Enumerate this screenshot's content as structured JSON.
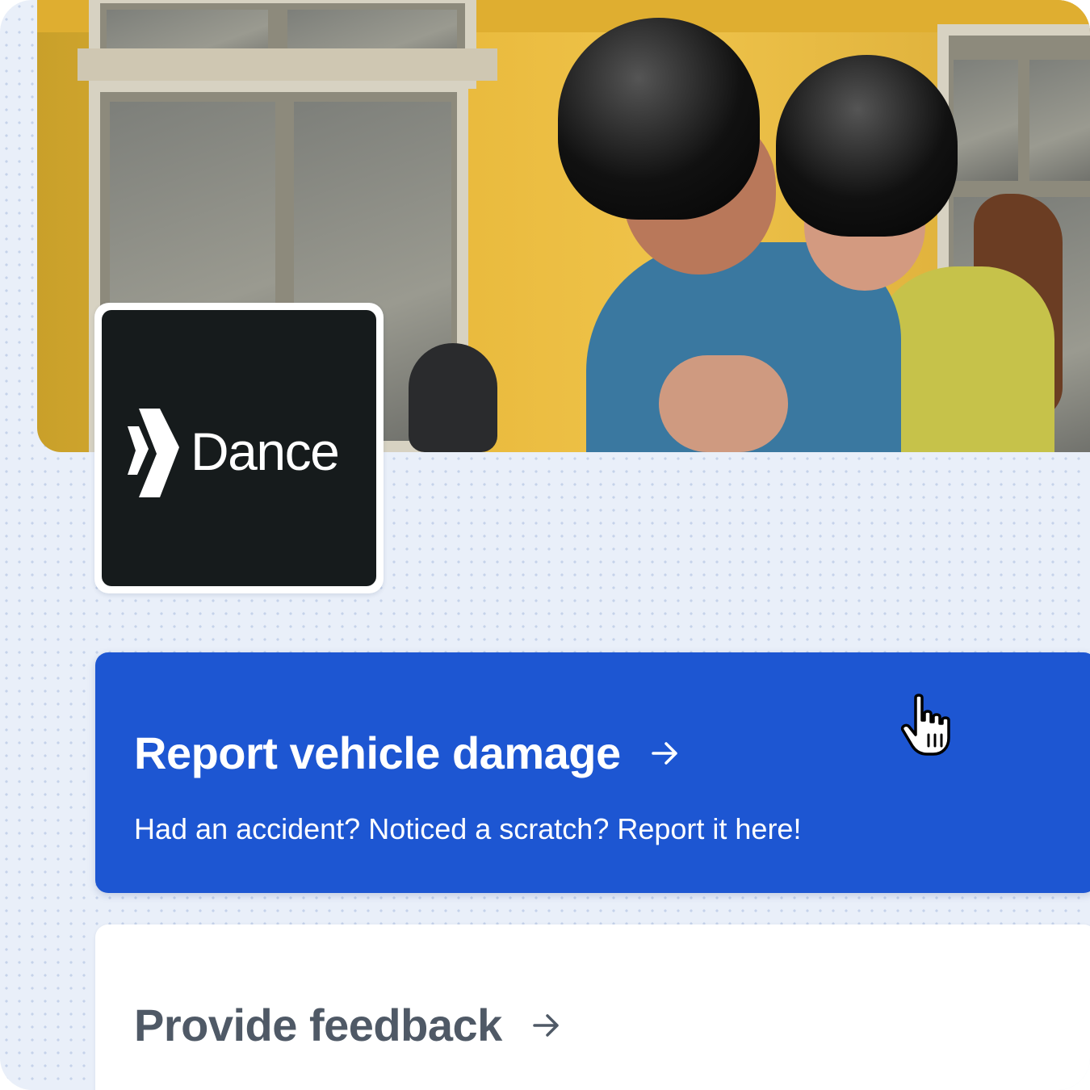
{
  "brand": {
    "name": "Dance",
    "logo_bg": "#161b1c",
    "accent": "#1d56d2"
  },
  "hero": {
    "image": "photo-couple-on-scooter-helmets",
    "bg": "#efc34a"
  },
  "cards": {
    "report": {
      "title": "Report vehicle damage",
      "description": "Had an accident? Noticed a scratch? Report it here!",
      "icon": "arrow-right-icon",
      "bg": "#1d56d2"
    },
    "feedback": {
      "title": "Provide feedback",
      "icon": "arrow-right-icon",
      "bg": "#ffffff"
    }
  },
  "cursor": {
    "icon": "hand-pointer-icon"
  }
}
